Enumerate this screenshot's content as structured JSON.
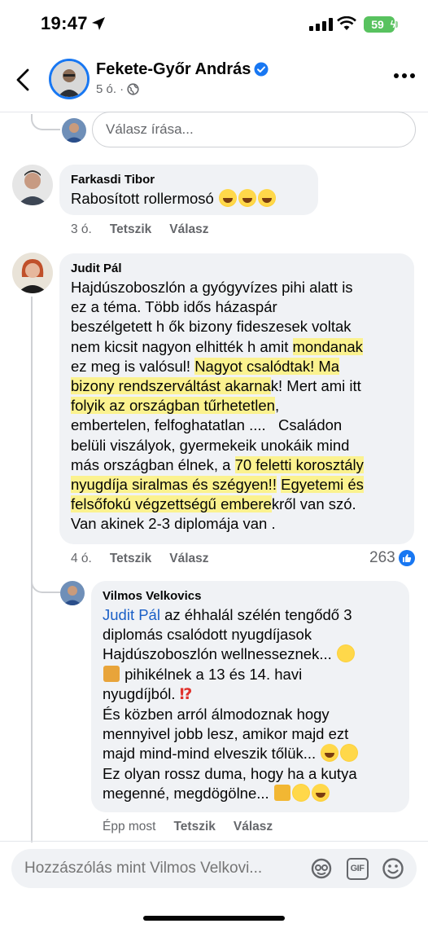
{
  "status_bar": {
    "time": "19:47",
    "battery": "59"
  },
  "header": {
    "name": "Fekete-Győr András",
    "meta": "5 ó. ·"
  },
  "reply_box": {
    "placeholder": "Válasz írása..."
  },
  "comments": [
    {
      "author": "Farkasdi Tibor",
      "text": "Rabosított rollermosó",
      "time": "3 ó.",
      "like": "Tetszik",
      "reply": "Válasz"
    },
    {
      "author": "Judit Pál",
      "time": "4 ó.",
      "like": "Tetszik",
      "reply": "Válasz",
      "reaction_count": "263",
      "text_parts": {
        "p1": "Hajdúszoboszlón a gyógyvízes pihi alatt is\nez a téma. Több idős házaspár\nbeszélgetett h ők bizony fideszesek voltak\nnem kicsit nagyon elhitték h amit ",
        "h1": "mondanak",
        "p2": "\nez meg is valósul! ",
        "h2": "Nagyot csalódtak! Ma\nbizony rendszerváltást akarna",
        "p3": "k! Mert ami itt\n",
        "h3": "folyik az országban tűrhetetlen",
        "p4": ",\nembertelen, felfoghatatlan ....   Családon\nbelüli viszályok, gyermekeik unokáik mind\nmás országban élnek, a ",
        "h4": "70 feletti korosztály\nnyugdíja siralmas és szégyen!!",
        "p5": " ",
        "h5": "Egyetemi és\nfelsőfokú végzettségű embere",
        "p6": "kről van szó.\nVan akinek 2-3 diplomája van ."
      }
    },
    {
      "author": "Vilmos Velkovics",
      "mention": "Judit Pál",
      "line1": " az éhhalál szélén tengődő 3\ndiplomás csalódott nyugdíjasok\nHajdúszoboszlón wellnesseznek... ",
      "line2": " pihikélnek a 13 és 14. havi\nnyugdíjból. ",
      "exclaim": "⁉",
      "line3": "\nÉs közben arról álmodoznak hogy\nmennyivel jobb lesz, amikor majd ezt\nmajd mind-mind elveszik tőlük... ",
      "line4": "\nEz olyan rossz duma, hogy ha a kutya\nmegenné, megdögölne... ",
      "time": "Épp most",
      "like": "Tetszik",
      "reply": "Válasz"
    }
  ],
  "composer": {
    "placeholder": "Hozzászólás mint Vilmos Velkovi..."
  },
  "icons": {
    "back": "chevron-left-icon",
    "verified": "verified-badge-icon",
    "privacy": "globe-icon",
    "more": "more-icon",
    "like": "like-reaction-icon",
    "sticker": "sticker-icon",
    "gif": "gif-icon",
    "emoji": "emoji-icon"
  },
  "colors": {
    "accent": "#1877f2",
    "highlight": "#fbf28f",
    "bubble": "#f0f2f5",
    "muted": "#65676b"
  }
}
